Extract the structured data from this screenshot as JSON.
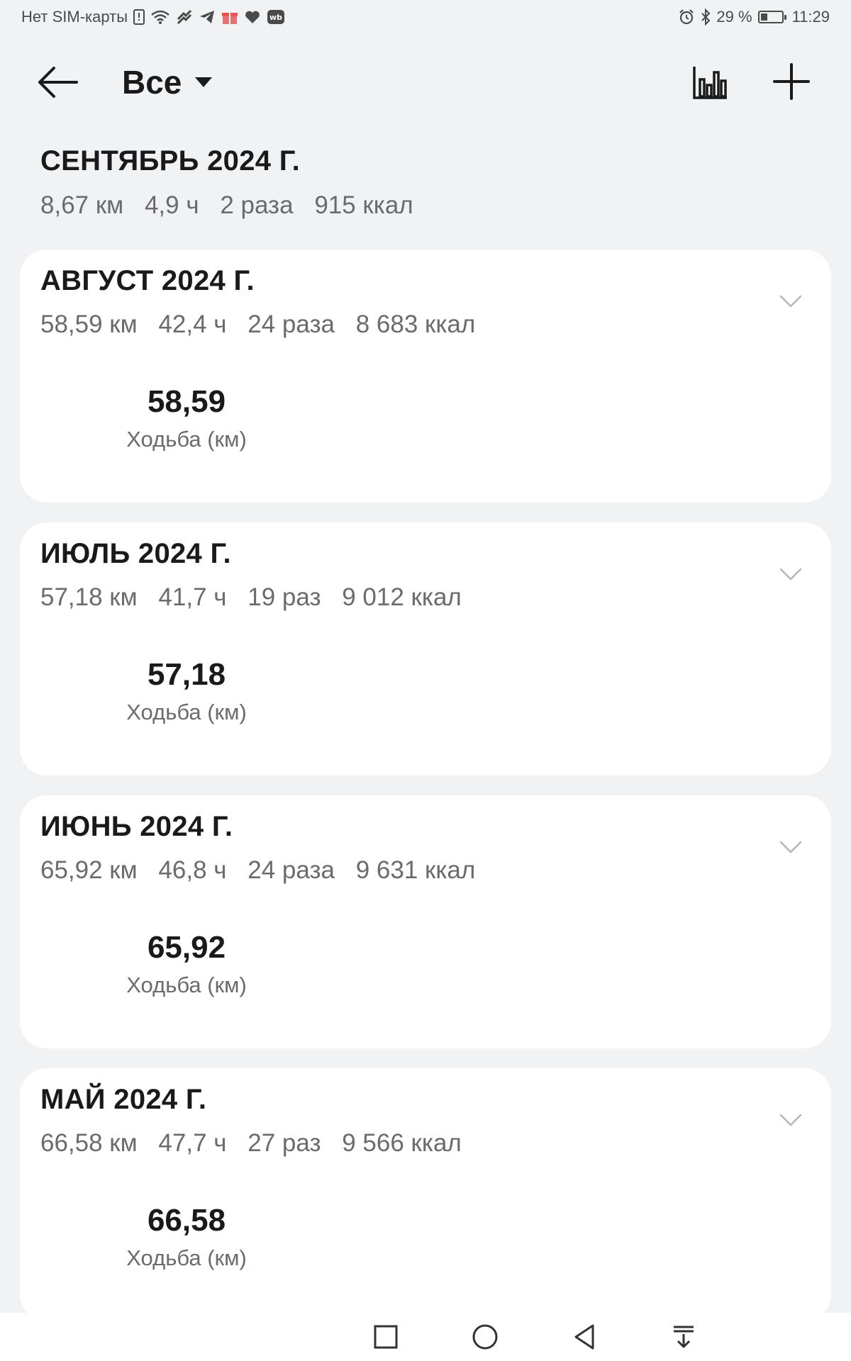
{
  "status_bar": {
    "carrier": "Нет SIM-карты",
    "battery": "29 %",
    "time": "11:29",
    "icons": [
      "sim-alert-icon",
      "wifi-icon",
      "app-icon",
      "telegram-icon",
      "gift-icon",
      "heart-icon",
      "wb-icon",
      "alarm-icon",
      "bluetooth-icon",
      "battery-icon"
    ],
    "wb_label": "wb",
    "battery_level_percent": 29
  },
  "toolbar": {
    "filter_label": "Все",
    "icons": [
      "back-arrow-icon",
      "dropdown-triangle-icon",
      "bar-chart-icon",
      "plus-icon"
    ]
  },
  "current_month": {
    "title": "СЕНТЯБРЬ 2024 Г.",
    "distance": "8,67 км",
    "duration": "4,9 ч",
    "count": "2 раза",
    "calories": "915 ккал"
  },
  "months": [
    {
      "title": "АВГУСТ 2024 Г.",
      "distance": "58,59 км",
      "duration": "42,4 ч",
      "count": "24 раза",
      "calories": "8 683 ккал",
      "value": "58,59",
      "label": "Ходьба (км)"
    },
    {
      "title": "ИЮЛЬ 2024 Г.",
      "distance": "57,18 км",
      "duration": "41,7 ч",
      "count": "19 раз",
      "calories": "9 012 ккал",
      "value": "57,18",
      "label": "Ходьба (км)"
    },
    {
      "title": "ИЮНЬ 2024 Г.",
      "distance": "65,92 км",
      "duration": "46,8 ч",
      "count": "24 раза",
      "calories": "9 631 ккал",
      "value": "65,92",
      "label": "Ходьба (км)"
    },
    {
      "title": "МАЙ 2024 Г.",
      "distance": "66,58 км",
      "duration": "47,7 ч",
      "count": "27 раз",
      "calories": "9 566 ккал",
      "value": "66,58",
      "label": "Ходьба (км)"
    }
  ],
  "nav_bar": {
    "icons": [
      "recent-apps-square-icon",
      "home-circle-icon",
      "back-triangle-icon",
      "notification-pull-down-icon"
    ]
  },
  "colors": {
    "background": "#f1f2f4",
    "card": "#ffffff",
    "text_primary": "#1a1a1a",
    "text_secondary": "#6b6b6b"
  }
}
